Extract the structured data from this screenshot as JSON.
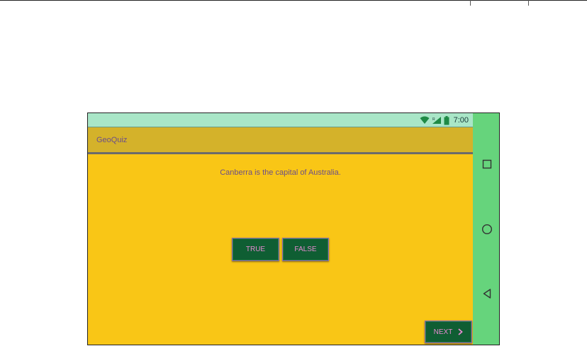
{
  "status_bar": {
    "time": "7:00",
    "icons": [
      "wifi-icon",
      "signal-icon",
      "battery-icon"
    ]
  },
  "app_bar": {
    "title": "GeoQuiz"
  },
  "quiz": {
    "question": "Canberra is the capital of Australia.",
    "true_label": "TRUE",
    "false_label": "FALSE",
    "next_label": "NEXT",
    "next_icon": "chevron-right-icon"
  },
  "nav_bar": {
    "buttons": [
      "recents-square-icon",
      "home-circle-icon",
      "back-triangle-icon"
    ]
  },
  "colors": {
    "background": "#f9c616",
    "app_bar": "#d4b22a",
    "status_bar": "#a9e6c7",
    "nav_bar": "#66d47c",
    "button": "#0f5e33",
    "button_text": "#e58ad0",
    "text": "#6b4e8a"
  }
}
